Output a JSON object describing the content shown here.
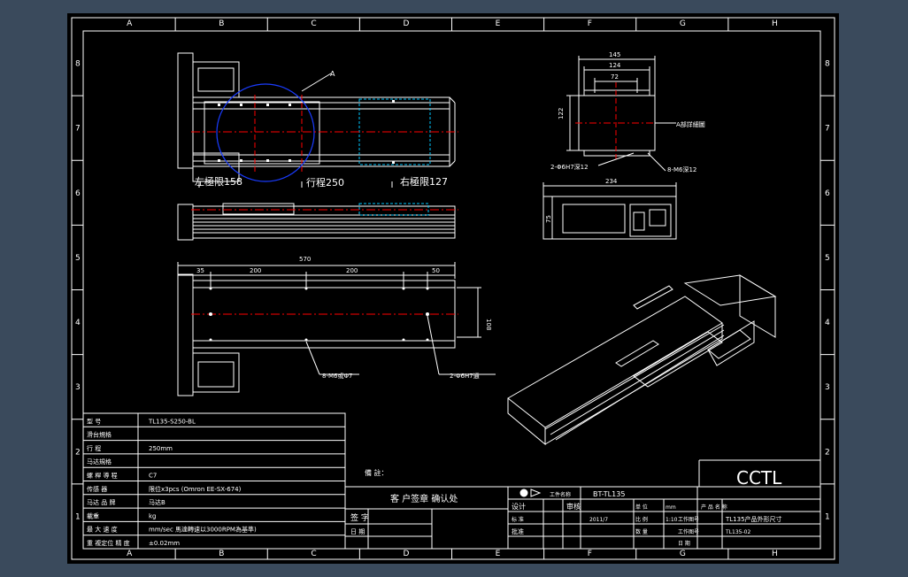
{
  "border": {
    "columns": [
      "A",
      "B",
      "C",
      "D",
      "E",
      "F",
      "G",
      "H"
    ],
    "rows": [
      "8",
      "7",
      "6",
      "5",
      "4",
      "3",
      "2",
      "1"
    ]
  },
  "top_view": {
    "detail_label": "A",
    "left_limit": "左極限158",
    "stroke": "行程250",
    "right_limit": "右極限127"
  },
  "bottom_view": {
    "overall_length": "570",
    "dim_35": "35",
    "dim_200a": "200",
    "dim_200b": "200",
    "dim_50": "50",
    "height_dim": "108",
    "callout_holes": "8-M6或Φ7",
    "callout_pin": "2-Φ6H7通"
  },
  "end_view": {
    "dim_145": "145",
    "dim_124": "124",
    "dim_72": "72",
    "dim_122": "122",
    "detail_note": "A部詳細圖",
    "callout_pin": "2-Φ6H7深12",
    "callout_tap": "8-M6深12",
    "dim_234": "234",
    "dim_75": "75"
  },
  "spec_table": [
    {
      "label": "型 号",
      "value": "TL135-S250-BL"
    },
    {
      "label": "滑台規格",
      "value": ""
    },
    {
      "label": "行 程",
      "value": "250mm"
    },
    {
      "label": "马达規格",
      "value": ""
    },
    {
      "label": "螺 桿 導 程",
      "value": "C7"
    },
    {
      "label": "传感 器",
      "value": "限位x3pcs (Omron EE-SX-674)"
    },
    {
      "label": "马达 品 牌",
      "value": "马达B"
    },
    {
      "label": "載重",
      "value": "kg"
    },
    {
      "label": "最 大 速 度",
      "value": "mm/sec 馬達轉速以3000RPM為基準)"
    },
    {
      "label": "重 複定位 精 度",
      "value": "±0.02mm"
    }
  ],
  "title_block": {
    "notes_label": "備 註：",
    "customer_confirm": "客 户签章 确认处",
    "sign": "签 字",
    "date": "日 期",
    "drawing_name_label": "工件名称",
    "drawing_name": "BT-TL135",
    "design": "设计",
    "check": "审核",
    "standard": "标 准",
    "approve": "批准",
    "unit_label": "单 位",
    "unit_value": "mm",
    "scale_label": "比 例",
    "scale_value": "1:10",
    "quantity_label": "数 量",
    "product_name_label": "产 品 名 称",
    "product_name": "TL135产品外形尺寸",
    "drawing_no_label": "工作图号",
    "drawing_no": "TL135-02",
    "drawing_no_label2": "工作图号",
    "date_label": "日 期",
    "date_value": "2011/7",
    "company": "CCTL"
  },
  "colors": {
    "background": "#3a4a5c",
    "sheet": "#000000",
    "line": "#ffffff",
    "centerline": "#ff0000",
    "detail_circle": "#1a3cff",
    "hidden": "#00c8ff"
  }
}
